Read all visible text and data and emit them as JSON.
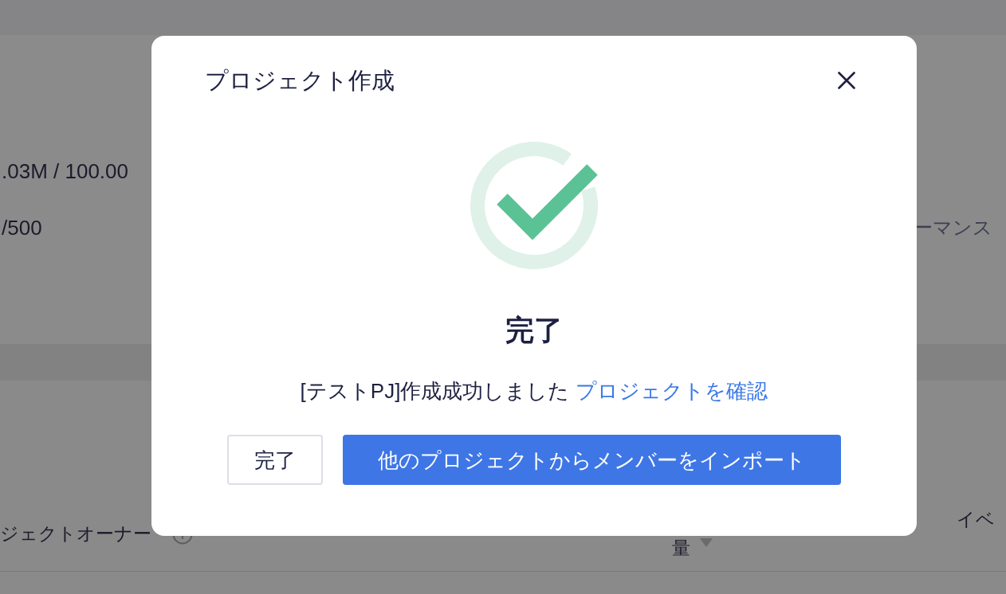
{
  "background": {
    "stats": [
      ".03M / 100.00",
      "/500"
    ],
    "side_label": "ーマンス",
    "table_headers": [
      {
        "label": "ジェクトオーナー",
        "kind": "info"
      },
      {
        "label": "量",
        "kind": "sort"
      },
      {
        "label": "イベ",
        "kind": "plain"
      }
    ]
  },
  "dialog": {
    "title": "プロジェクト作成",
    "status": "完了",
    "message": "[テストPJ]作成成功しました",
    "link": "プロジェクトを確認",
    "buttons": [
      {
        "label": "完了",
        "kind": "secondary"
      },
      {
        "label": "他のプロジェクトからメンバーをインポート",
        "kind": "primary"
      }
    ]
  }
}
